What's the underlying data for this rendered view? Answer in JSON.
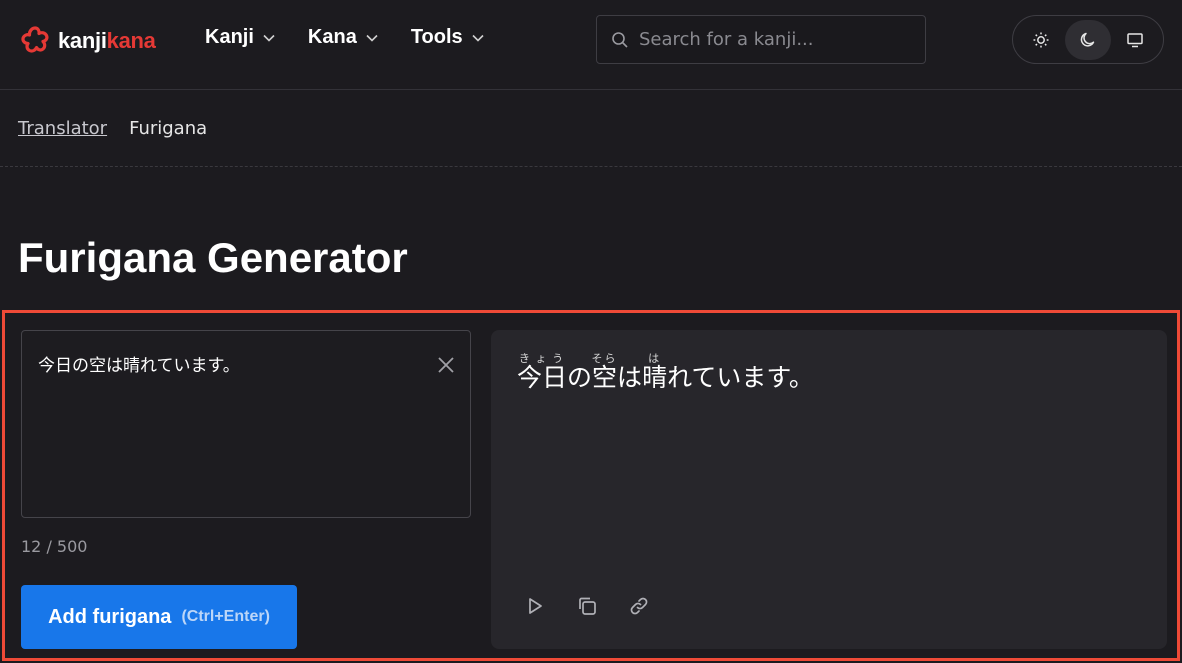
{
  "header": {
    "logo": {
      "part1": "kanji",
      "part2": "kana",
      "brand_color": "#e53935"
    },
    "nav": [
      {
        "label": "Kanji",
        "icon": "chevron-down-icon"
      },
      {
        "label": "Kana",
        "icon": "chevron-down-icon"
      },
      {
        "label": "Tools",
        "icon": "chevron-down-icon"
      }
    ],
    "search": {
      "placeholder": "Search for a kanji...",
      "value": "",
      "icon": "search-icon"
    },
    "theme": {
      "options": [
        "sun-icon",
        "moon-icon",
        "monitor-icon"
      ],
      "active": "moon-icon"
    }
  },
  "breadcrumb": {
    "link": "Translator",
    "current": "Furigana"
  },
  "page": {
    "title": "Furigana Generator"
  },
  "tool": {
    "input_value": "今日の空は晴れています。",
    "char_count": "12 / 500",
    "button_label": "Add furigana",
    "button_shortcut": "(Ctrl+Enter)",
    "accent_color": "#1877ea",
    "highlight_border": "#ee4a37",
    "output": {
      "segments": [
        {
          "base": "今日",
          "reading": "きょう"
        },
        {
          "text": "の"
        },
        {
          "base": "空",
          "reading": "そら"
        },
        {
          "text": "は"
        },
        {
          "base": "晴",
          "reading": "は"
        },
        {
          "text": "れています。"
        }
      ]
    },
    "actions": [
      "play-icon",
      "copy-icon",
      "link-icon"
    ]
  }
}
